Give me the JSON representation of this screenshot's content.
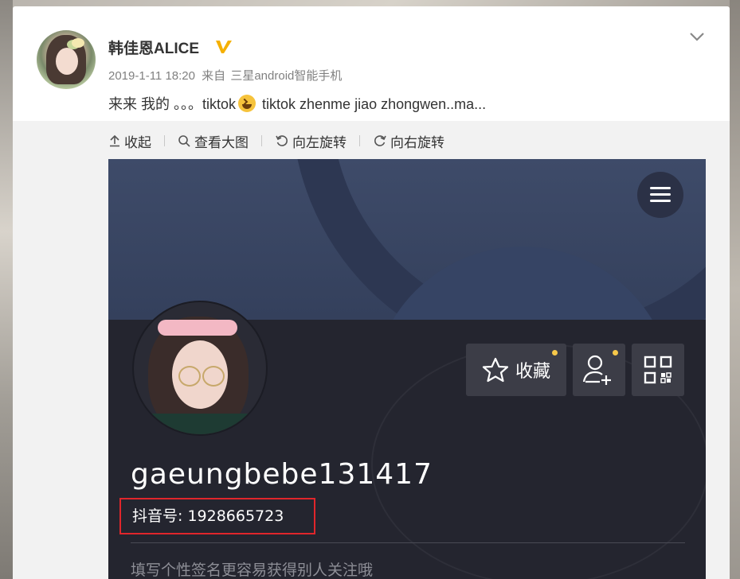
{
  "post": {
    "author": "韩佳恩ALICE",
    "verified_icon": "verified-v-icon",
    "timestamp": "2019-1-11 18:20",
    "source_prefix": "来自",
    "source": "三星android智能手机",
    "text_before_emoji": "来来 我的 。。。tiktok",
    "emoji": "laughing-emoji",
    "text_after_emoji": " tiktok zhenme jiao zhongwen..ma..."
  },
  "toolbar": {
    "collapse": "收起",
    "view_large": "查看大图",
    "rotate_left": "向左旋转",
    "rotate_right": "向右旋转"
  },
  "screenshot": {
    "favorite_label": "收藏",
    "username": "gaeungbebe131417",
    "douyin_id": "抖音号: 1928665723",
    "bio_placeholder": "填写个性签名更容易获得别人关注哦",
    "colors": {
      "header_bg": "#3e4b69",
      "body_bg": "#24252f",
      "highlight_box": "#e0262b",
      "notification_dot": "#f6c84a"
    }
  }
}
